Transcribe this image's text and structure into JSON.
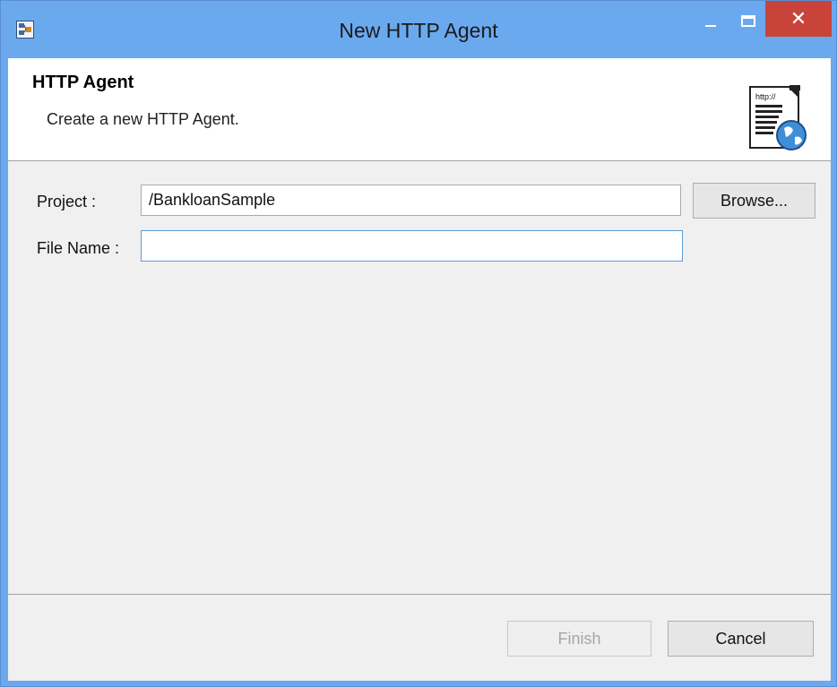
{
  "window": {
    "title": "New HTTP Agent",
    "close_glyph": "✕",
    "title_bar_color": "#6ba9ef",
    "close_button_color": "#c8443a"
  },
  "banner": {
    "title": "HTTP Agent",
    "description": "Create a new HTTP Agent.",
    "icon_text": "http://",
    "icon": "http-document-globe-icon"
  },
  "form": {
    "project_label": "Project :",
    "project_value": "/BankloanSample",
    "browse_label": "Browse...",
    "file_name_label": "File Name :",
    "file_name_value": ""
  },
  "footer": {
    "finish_label": "Finish",
    "cancel_label": "Cancel"
  }
}
